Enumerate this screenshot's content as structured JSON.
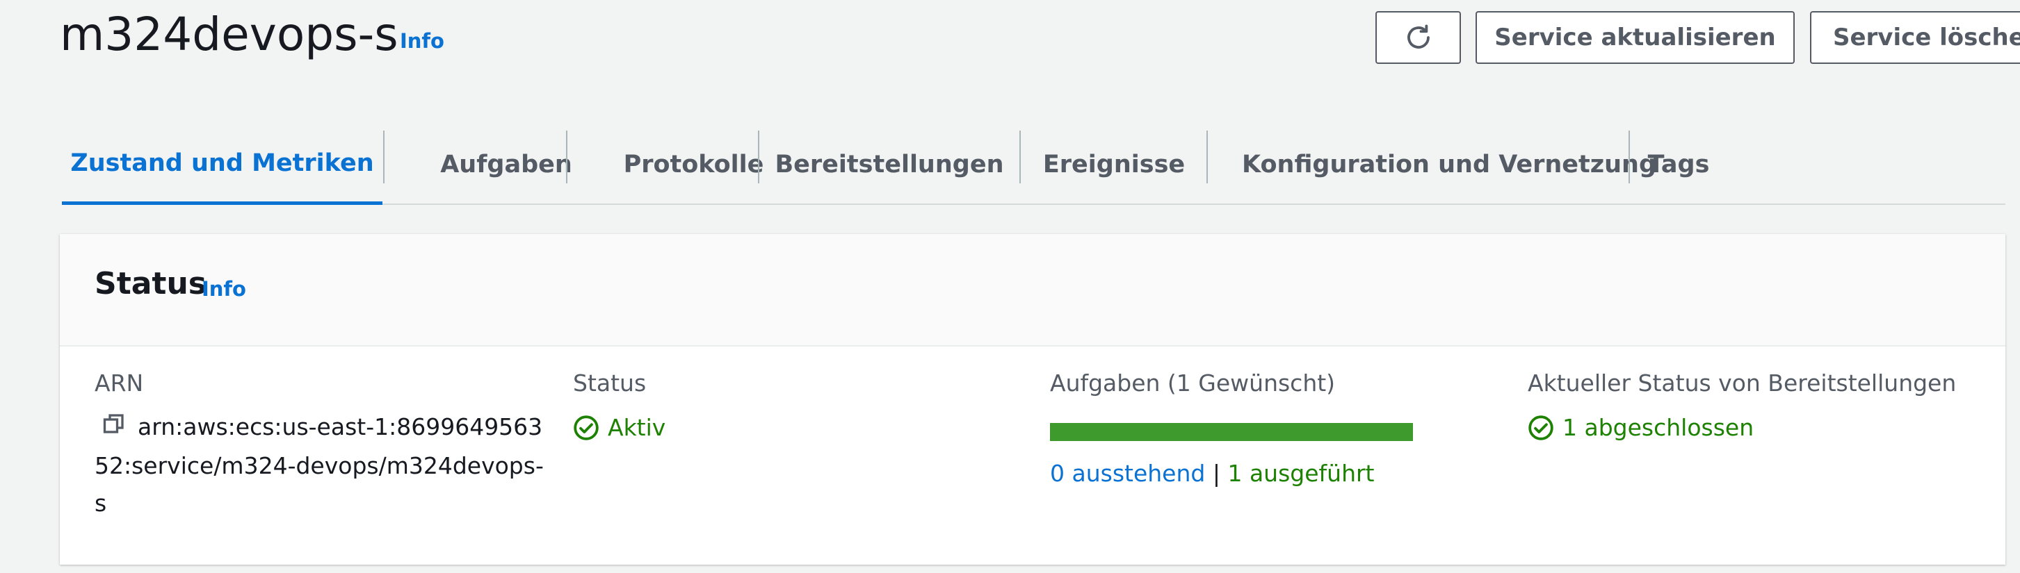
{
  "header": {
    "title": "m324devops-s",
    "info_label": "Info",
    "buttons": {
      "refresh_icon": "refresh-icon",
      "update_label": "Service aktualisieren",
      "delete_label": "Service löschen"
    }
  },
  "tabs": [
    {
      "label": "Zustand und Metriken",
      "active": true
    },
    {
      "label": "Aufgaben",
      "active": false
    },
    {
      "label": "Protokolle",
      "active": false
    },
    {
      "label": "Bereitstellungen",
      "active": false
    },
    {
      "label": "Ereignisse",
      "active": false
    },
    {
      "label": "Konfiguration und Vernetzung",
      "active": false
    },
    {
      "label": "Tags",
      "active": false
    }
  ],
  "status_panel": {
    "title": "Status",
    "info_label": "Info",
    "arn": {
      "label": "ARN",
      "value": "arn:aws:ecs:us-east-1:869964956352:service/m324-devops/m324devops-s",
      "copy_icon": "copy-icon"
    },
    "status": {
      "label": "Status",
      "value": "Aktiv",
      "icon": "check-circle-icon"
    },
    "tasks": {
      "label": "Aufgaben (1 Gewünscht)",
      "progress_fraction": 1.0,
      "pending": "0 ausstehend",
      "separator": "|",
      "running": "1 ausgeführt"
    },
    "deployments": {
      "label": "Aktueller Status von Bereitstellungen",
      "value": "1 abgeschlossen",
      "icon": "check-circle-icon"
    }
  },
  "colors": {
    "accent_blue": "#0972d3",
    "success_green": "#1d8102",
    "progress_green": "#3f9a2e",
    "text_secondary": "#545b64"
  }
}
